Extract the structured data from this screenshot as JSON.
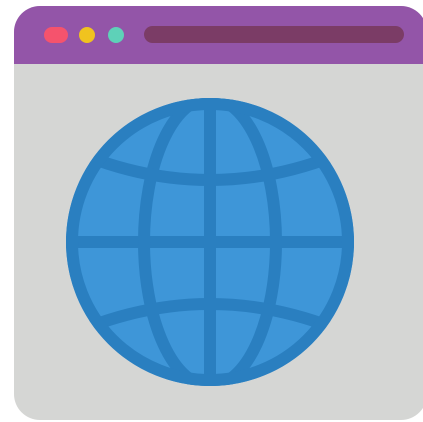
{
  "window": {
    "titlebar_color": "#9355a8",
    "background_color": "#d5d6d4",
    "controls": [
      {
        "icon": "close-dot-icon",
        "color": "#f5536d"
      },
      {
        "icon": "minimize-dot-icon",
        "color": "#f0c31f"
      },
      {
        "icon": "maximize-dot-icon",
        "color": "#5ed1b8"
      }
    ],
    "address_bar_color": "#7b3c66"
  },
  "globe": {
    "icon": "globe-icon",
    "fill_color": "#3e96d8",
    "line_color": "#2a7fc0"
  }
}
